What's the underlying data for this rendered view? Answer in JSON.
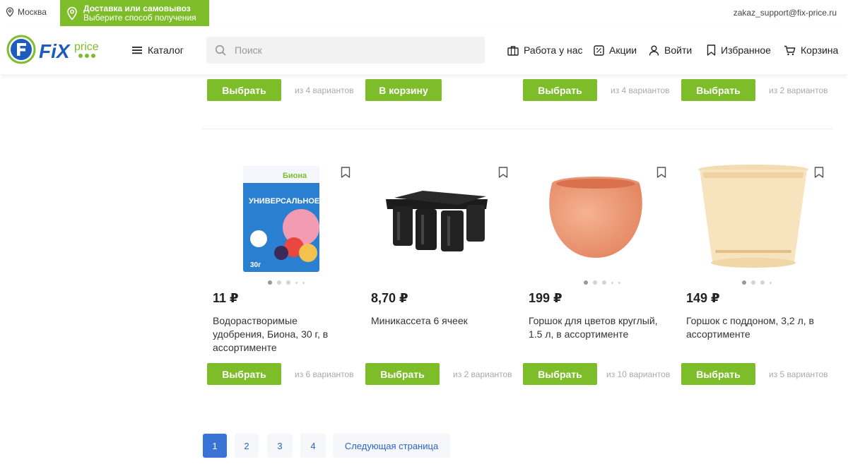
{
  "topbar": {
    "city": "Москва",
    "delivery_title": "Доставка или самовывоз",
    "delivery_subtitle": "Выберите способ получения",
    "support_email": "zakaz_support@fix-price.ru"
  },
  "header": {
    "logo_text_fix": "FiX",
    "logo_text_price": "price",
    "catalog_label": "Каталог",
    "search_placeholder": "Поиск",
    "nav": {
      "work": "Работа у нас",
      "promo": "Акции",
      "login": "Войти",
      "favorites": "Избранное",
      "cart": "Корзина"
    }
  },
  "top_row": [
    {
      "button": "Выбрать",
      "variants": "из 4 вариантов"
    },
    {
      "button": "В корзину",
      "variants": ""
    },
    {
      "button": "Выбрать",
      "variants": "из 4 вариантов"
    },
    {
      "button": "Выбрать",
      "variants": "из 2 вариантов"
    }
  ],
  "products": [
    {
      "price": "11 ₽",
      "title": "Водорастворимые удобрения, Биона, 30 г, в ассортименте",
      "button": "Выбрать",
      "variants": "из 6 вариантов",
      "image": "fertilizer-pack",
      "package_brand": "Биона",
      "package_text": "УНИВЕРСАЛЬНОЕ",
      "package_weight": "30г"
    },
    {
      "price": "8,70 ₽",
      "title": "Миникассета 6 ячеек",
      "button": "Выбрать",
      "variants": "из 2 вариантов",
      "image": "seedling-tray"
    },
    {
      "price": "199 ₽",
      "title": "Горшок для цветов круглый, 1.5 л, в ассортименте",
      "button": "Выбрать",
      "variants": "из 10 вариантов",
      "image": "round-pot-orange"
    },
    {
      "price": "149 ₽",
      "title": "Горшок с поддоном, 3,2 л, в ассортименте",
      "button": "Выбрать",
      "variants": "из 5 вариантов",
      "image": "pot-with-tray-beige"
    }
  ],
  "pagination": {
    "pages": [
      "1",
      "2",
      "3",
      "4"
    ],
    "current": "1",
    "next_label": "Следующая страница"
  },
  "colors": {
    "brand_green": "#7dbd2a",
    "brand_blue": "#1d5bbf",
    "pager_active": "#3a73d6"
  }
}
